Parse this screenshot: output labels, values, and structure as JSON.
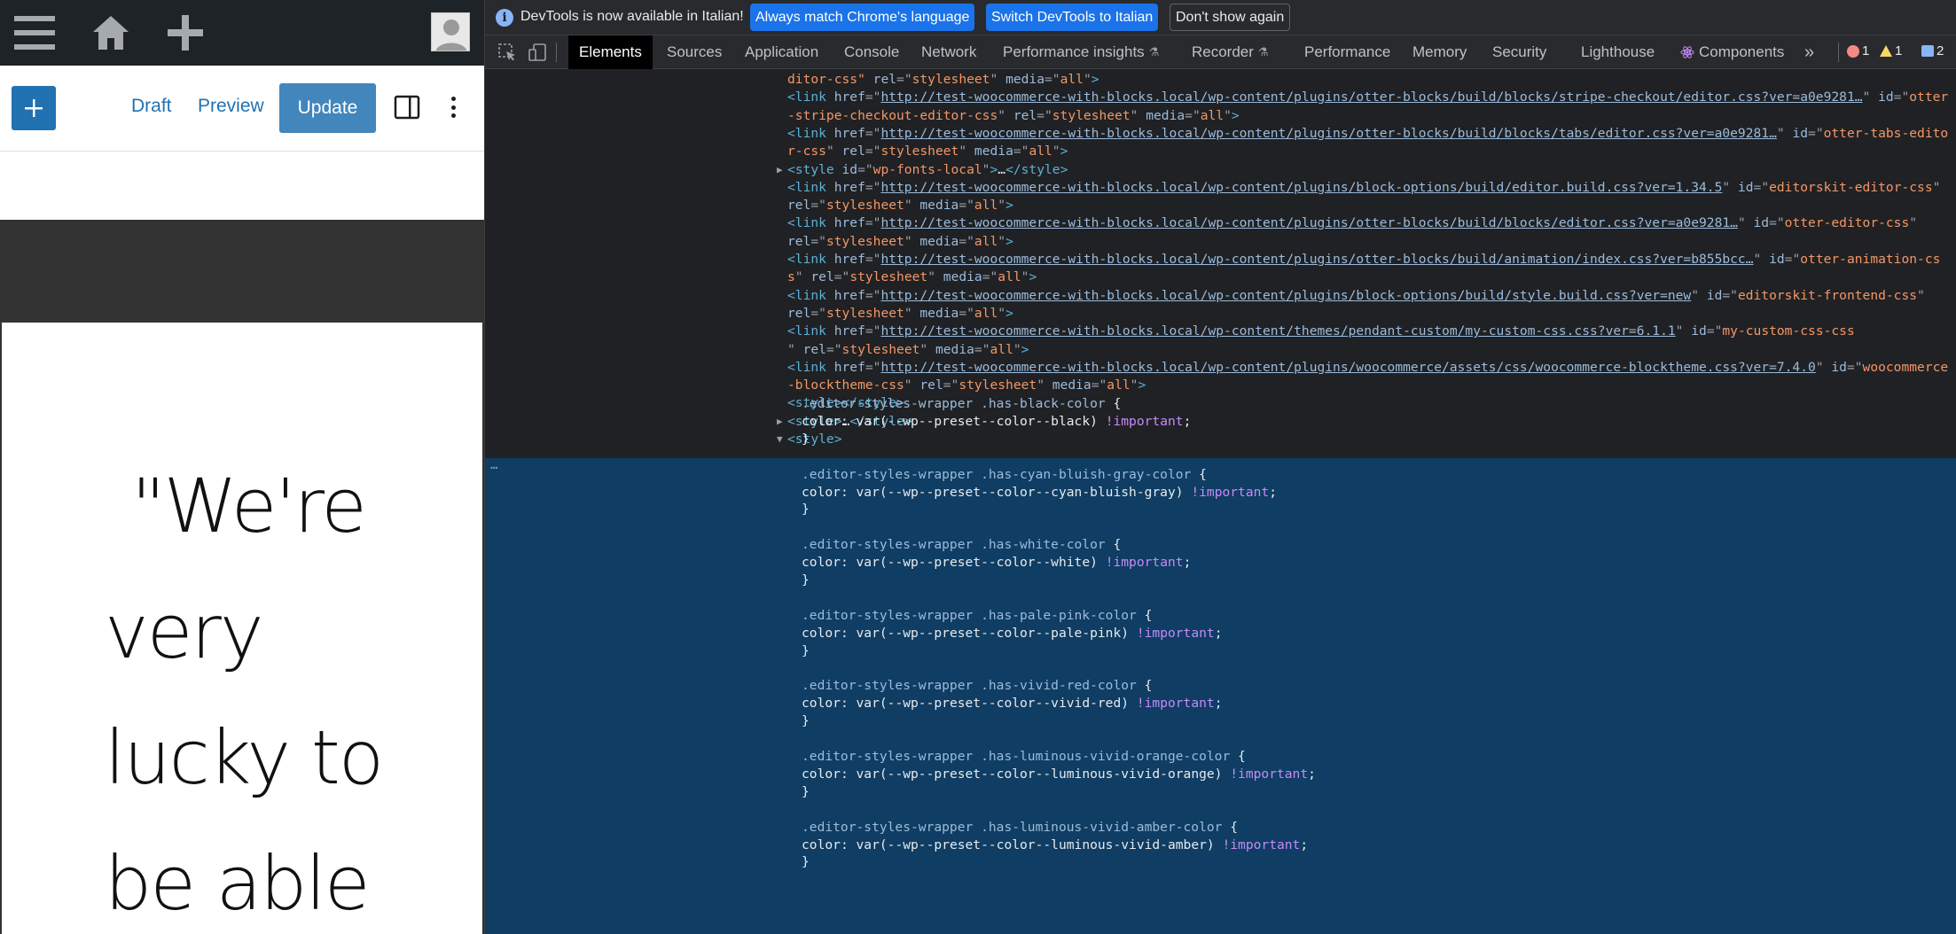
{
  "wp": {
    "toolbar": {
      "draft_label": "Draft",
      "preview_label": "Preview",
      "update_label": "Update"
    },
    "quote_lines": [
      "\"We're",
      "very",
      "lucky to",
      "be able"
    ]
  },
  "devtools": {
    "infobar": {
      "message": "DevTools is now available in Italian!",
      "match_label": "Always match Chrome's language",
      "switch_label": "Switch DevTools to Italian",
      "dismiss_label": "Don't show again"
    },
    "tabs": {
      "elements": "Elements",
      "sources": "Sources",
      "application": "Application",
      "console": "Console",
      "network": "Network",
      "perfinsights": "Performance insights",
      "recorder": "Recorder",
      "performance": "Performance",
      "memory": "Memory",
      "security": "Security",
      "lighthouse": "Lighthouse",
      "components": "Components",
      "overflow": "»"
    },
    "counters": {
      "errors": "1",
      "warnings": "1",
      "issues": "2"
    },
    "colors": {
      "accent": "#1a73e8",
      "selection": "#0f3d63",
      "wp_blue": "#2271b1"
    },
    "code": {
      "l0": {
        "a": "ditor-css\"",
        "b": " rel",
        "c": "=\"",
        "d": "stylesheet",
        "e": "\" media",
        "f": "=\"",
        "g": "all",
        "h": "\">"
      },
      "links": [
        {
          "url": "http://test-woocommerce-with-blocks.local/wp-content/plugins/otter-blocks/build/blocks/stripe-checkout/editor.css?ver=a0e9281…",
          "id1": "otter",
          "id2": "-stripe-checkout-editor-css"
        },
        {
          "url": "http://test-woocommerce-with-blocks.local/wp-content/plugins/otter-blocks/build/blocks/tabs/editor.css?ver=a0e9281…",
          "id1": "otter-tabs-edito",
          "id2": "r-css"
        },
        {
          "url": "http://test-woocommerce-with-blocks.local/wp-content/plugins/block-options/build/editor.build.css?ver=1.34.5",
          "id1": "editorskit-editor-css",
          "id2": ""
        },
        {
          "url": "http://test-woocommerce-with-blocks.local/wp-content/plugins/otter-blocks/build/blocks/editor.css?ver=a0e9281…",
          "id1": "otter-editor-css",
          "id2": ""
        },
        {
          "url": "http://test-woocommerce-with-blocks.local/wp-content/plugins/otter-blocks/build/animation/index.css?ver=b855bcc…",
          "id1": "otter-animation-cs",
          "id2": "s"
        },
        {
          "url": "http://test-woocommerce-with-blocks.local/wp-content/plugins/block-options/build/style.build.css?ver=new",
          "id1": "editorskit-frontend-css",
          "id2": ""
        },
        {
          "url": "http://test-woocommerce-with-blocks.local/wp-content/themes/pendant-custom/my-custom-css.css?ver=6.1.1",
          "id1": "my-custom-css-css",
          "id2": ""
        },
        {
          "url": "http://test-woocommerce-with-blocks.local/wp-content/plugins/woocommerce/assets/css/woocommerce-blocktheme.css?ver=7.4.0",
          "id1": "woocommerce",
          "id2": "-blocktheme-css"
        }
      ],
      "style_fonts_id": "wp-fonts-local",
      "rules": [
        {
          "sel": ".editor-styles-wrapper .has-black-color",
          "val": "var(--wp--preset--color--black)"
        },
        {
          "sel": ".editor-styles-wrapper .has-cyan-bluish-gray-color",
          "val": "var(--wp--preset--color--cyan-bluish-gray)"
        },
        {
          "sel": ".editor-styles-wrapper .has-white-color",
          "val": "var(--wp--preset--color--white)"
        },
        {
          "sel": ".editor-styles-wrapper .has-pale-pink-color",
          "val": "var(--wp--preset--color--pale-pink)"
        },
        {
          "sel": ".editor-styles-wrapper .has-vivid-red-color",
          "val": "var(--wp--preset--color--vivid-red)"
        },
        {
          "sel": ".editor-styles-wrapper .has-luminous-vivid-orange-color",
          "val": "var(--wp--preset--color--luminous-vivid-orange)"
        },
        {
          "sel": ".editor-styles-wrapper .has-luminous-vivid-amber-color",
          "val": "var(--wp--preset--color--luminous-vivid-amber)"
        }
      ],
      "tokens": {
        "link_open": "<link href=\"",
        "id_attr": "\" id=\"",
        "rel_tail": "\" rel=\"stylesheet\" media=\"all\">",
        "rel_only": "rel=\"stylesheet\" media=\"all\">",
        "style_open": "<style>",
        "style_close": "</style>",
        "style_empty": "<style></style>",
        "style_collapsed": "<style>…</style>",
        "style_id_open": "<style id=\"",
        "style_id_close": "\">…</style>",
        "color_prop": "color",
        "important": "!important",
        "open_brace": " {",
        "close_brace": "}",
        "colon": ": ",
        "semi": ";",
        "expand": "▶",
        "collapse": "▼",
        "dots": "…"
      }
    }
  }
}
